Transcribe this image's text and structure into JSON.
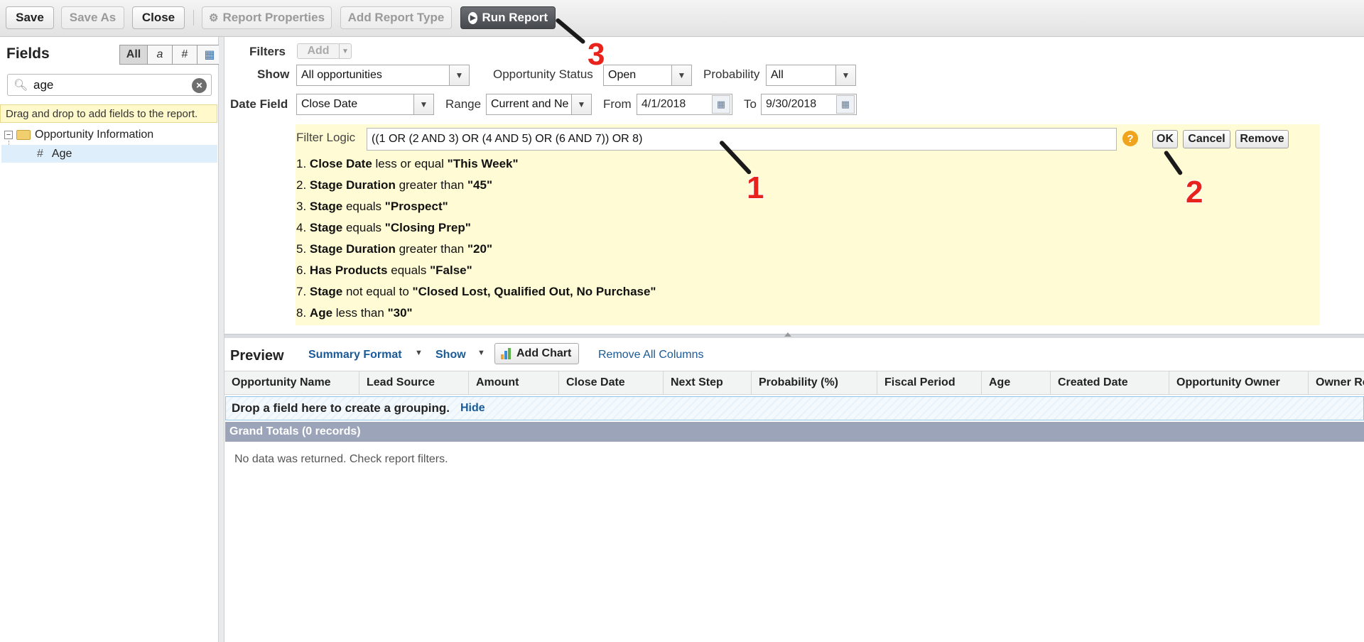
{
  "toolbar": {
    "save": "Save",
    "save_as": "Save As",
    "close": "Close",
    "report_properties": "Report Properties",
    "add_report_type": "Add Report Type",
    "run_report": "Run Report"
  },
  "fields_panel": {
    "title": "Fields",
    "tabs": [
      "All",
      "a",
      "#",
      "▦"
    ],
    "search_value": "age",
    "hint": "Drag and drop to add fields to the report.",
    "folder": "Opportunity Information",
    "item": "Age",
    "item_icon": "#"
  },
  "filters": {
    "label": "Filters",
    "add": "Add",
    "show_label": "Show",
    "show_value": "All opportunities",
    "status_label": "Opportunity Status",
    "status_value": "Open",
    "probability_label": "Probability",
    "probability_value": "All",
    "date_field_label": "Date Field",
    "date_field_value": "Close Date",
    "range_label": "Range",
    "range_value": "Current and Ne",
    "from_label": "From",
    "from_value": "4/1/2018",
    "to_label": "To",
    "to_value": "9/30/2018"
  },
  "filter_logic": {
    "label": "Filter Logic",
    "value": "((1 OR (2 AND 3) OR (4 AND 5) OR (6 AND 7)) OR 8)",
    "help": "?",
    "ok": "OK",
    "cancel": "Cancel",
    "remove": "Remove",
    "rows": [
      {
        "num": "1.",
        "field": "Close Date",
        "op": "less or equal",
        "value": "\"This Week\""
      },
      {
        "num": "2.",
        "field": "Stage Duration",
        "op": "greater than",
        "value": "\"45\""
      },
      {
        "num": "3.",
        "field": "Stage",
        "op": "equals",
        "value": "\"Prospect\""
      },
      {
        "num": "4.",
        "field": "Stage",
        "op": "equals",
        "value": "\"Closing Prep\""
      },
      {
        "num": "5.",
        "field": "Stage Duration",
        "op": "greater than",
        "value": "\"20\""
      },
      {
        "num": "6.",
        "field": "Has Products",
        "op": "equals",
        "value": "\"False\""
      },
      {
        "num": "7.",
        "field": "Stage",
        "op": "not equal to",
        "value": "\"Closed Lost, Qualified Out, No Purchase\""
      },
      {
        "num": "8.",
        "field": "Age",
        "op": "less than",
        "value": "\"30\""
      }
    ]
  },
  "preview": {
    "title": "Preview",
    "format": "Summary Format",
    "show": "Show",
    "add_chart": "Add Chart",
    "remove_columns": "Remove All Columns",
    "columns": [
      "Opportunity Name",
      "Lead Source",
      "Amount",
      "Close Date",
      "Next Step",
      "Probability (%)",
      "Fiscal Period",
      "Age",
      "Created Date",
      "Opportunity Owner",
      "Owner Rol"
    ],
    "drop_text": "Drop a field here to create a grouping.",
    "hide": "Hide",
    "grand_totals": "Grand Totals (0 records)",
    "no_data": "No data was returned. Check report filters."
  },
  "annotations": [
    "1",
    "2",
    "3"
  ],
  "colors": {
    "callout": "#e8231b",
    "link": "#1a5a99",
    "logic_bg": "#fffbd4",
    "totals_bg": "#9ba4b8"
  }
}
